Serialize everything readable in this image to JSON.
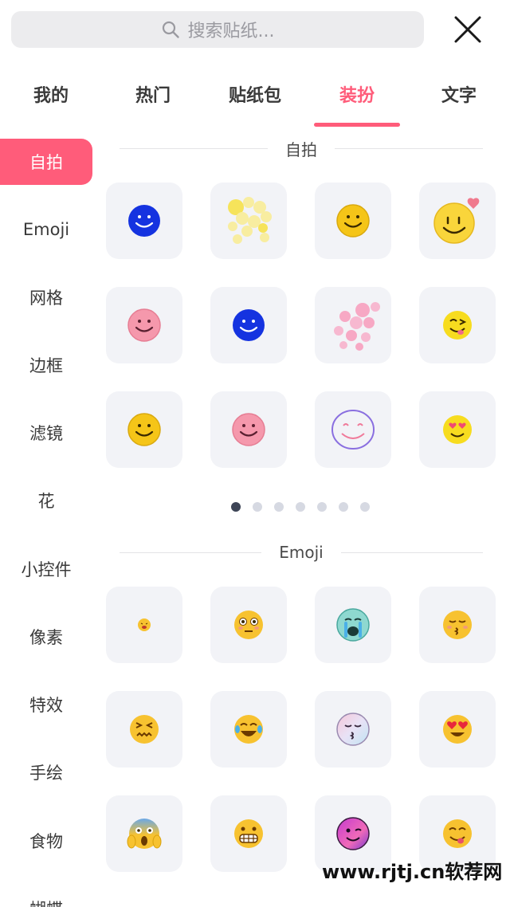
{
  "search": {
    "placeholder": "搜索贴纸..."
  },
  "tabs": [
    {
      "label": "我的"
    },
    {
      "label": "热门"
    },
    {
      "label": "贴纸包"
    },
    {
      "label": "装扮",
      "active": true
    },
    {
      "label": "文字"
    }
  ],
  "sidebar": {
    "items": [
      {
        "label": "自拍",
        "active": true
      },
      {
        "label": "Emoji"
      },
      {
        "label": "网格"
      },
      {
        "label": "边框"
      },
      {
        "label": "滤镜"
      },
      {
        "label": "花"
      },
      {
        "label": "小控件"
      },
      {
        "label": "像素"
      },
      {
        "label": "特效"
      },
      {
        "label": "手绘"
      },
      {
        "label": "食物"
      },
      {
        "label": "蝴蝶"
      }
    ]
  },
  "sections": [
    {
      "title": "自拍",
      "stickers": [
        "blue-smiley-sticker",
        "yellow-dots-sticker",
        "yellow-smiley-sticker",
        "yellow-heart-smiley-sticker",
        "pink-smiley-sticker",
        "blue-smiley-sticker",
        "pink-dots-sticker",
        "winking-tongue-smiley-sticker",
        "yellow-smiley-sticker",
        "pink-smiley-sticker",
        "outline-smiley-sticker",
        "heart-eyes-smiley-sticker"
      ]
    },
    {
      "title": "Emoji",
      "stickers": [
        "tiny-emoji-sticker",
        "flushed-emoji-sticker",
        "crying-emoji-sticker",
        "kissing-emoji-sticker",
        "confounded-emoji-sticker",
        "laughing-tears-emoji-sticker",
        "pastel-kissing-emoji-sticker",
        "heart-eyes-emoji-sticker",
        "screaming-emoji-sticker",
        "grimacing-emoji-sticker",
        "purple-winking-emoji-sticker",
        "yum-emoji-sticker"
      ]
    }
  ],
  "pagination": {
    "count": 7,
    "active": 0
  },
  "watermark": "www.rjtj.cn软荐网",
  "colors": {
    "accent": "#ff5c7a",
    "tile": "#f2f3f7",
    "dot_active": "#3d4456",
    "dot": "#d6d9e2"
  }
}
